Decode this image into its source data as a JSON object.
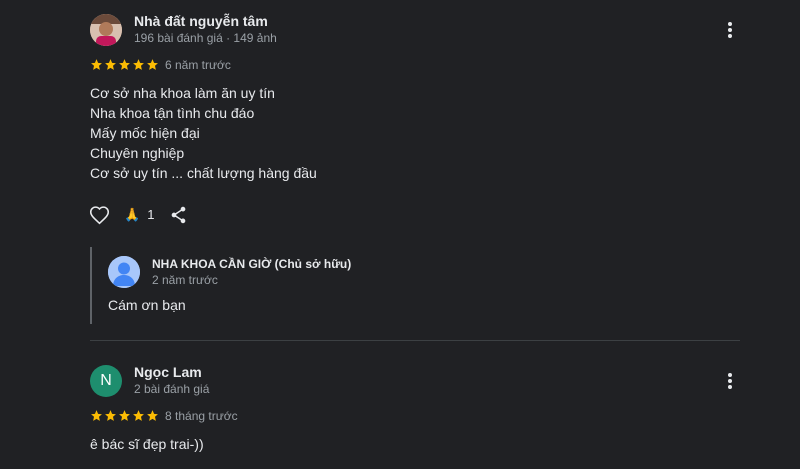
{
  "reviews": [
    {
      "name": "Nhà đất nguyễn tâm",
      "meta": "196 bài đánh giá · 149 ảnh",
      "date": "6 năm trước",
      "rating": 5,
      "lines": [
        "Cơ sở nha khoa làm ăn uy tín",
        "Nha khoa tận tình chu đáo",
        "Mấy mốc hiện đại",
        "Chuyên nghiệp",
        "Cơ sở uy tín ... chất lượng hàng đầu"
      ],
      "reaction_emoji": "🙏",
      "reaction_count": "1",
      "owner_reply": {
        "name": "NHA KHOA CẦN GIỜ (Chủ sở hữu)",
        "date": "2 năm trước",
        "text": "Cám ơn bạn"
      }
    },
    {
      "name": "Ngọc Lam",
      "meta": "2 bài đánh giá",
      "date": "8 tháng trước",
      "rating": 5,
      "avatar_letter": "N",
      "avatar_color": "#1e8e6e",
      "lines": [
        "ê bác sĩ đẹp trai-))"
      ]
    }
  ],
  "colors": {
    "star": "#fbbc04",
    "background": "#202124"
  }
}
